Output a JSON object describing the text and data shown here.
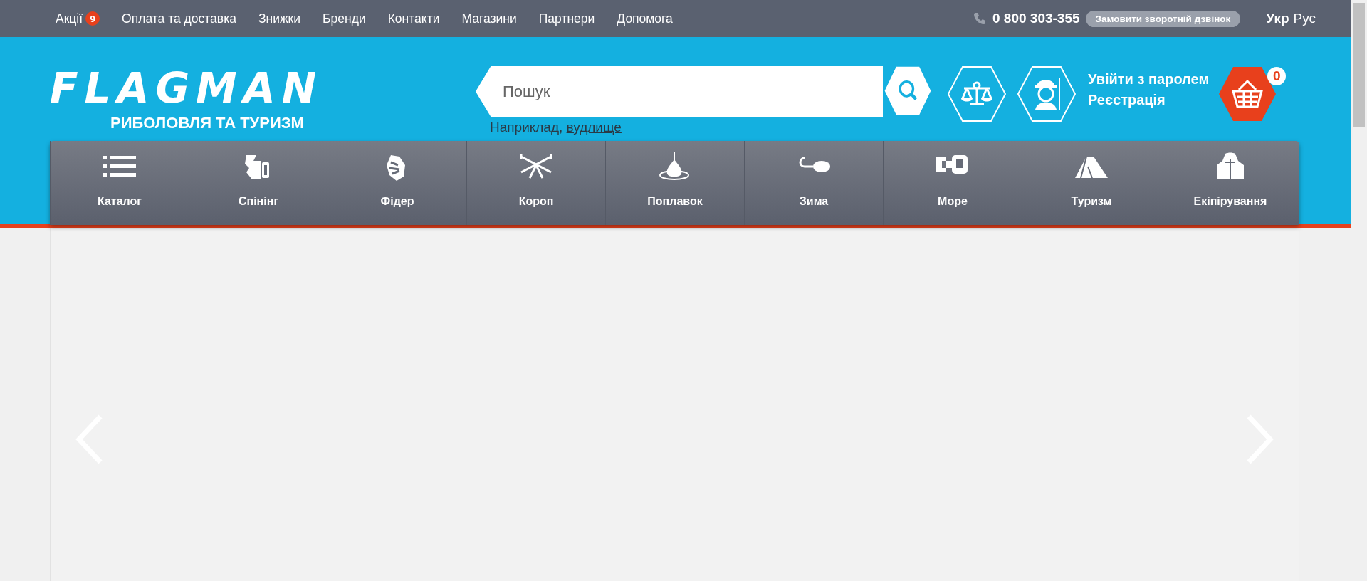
{
  "top_links": [
    {
      "label": "Акції",
      "badge": "9"
    },
    {
      "label": "Оплата та доставка"
    },
    {
      "label": "Знижки"
    },
    {
      "label": "Бренди"
    },
    {
      "label": "Контакти"
    },
    {
      "label": "Магазини"
    },
    {
      "label": "Партнери"
    },
    {
      "label": "Допомога"
    }
  ],
  "phone": "0 800 303-355",
  "callback_button": "Замовити зворотній дзвінок",
  "languages": [
    {
      "label": "Укр",
      "selected": true
    },
    {
      "label": "Рус",
      "selected": false
    }
  ],
  "logo": {
    "name": "FLAGMAN",
    "tagline": "РИБОЛОВЛЯ ТА ТУРИЗМ"
  },
  "search": {
    "placeholder": "Пошук",
    "hint": "Наприклад,",
    "hint_link": "вудлище"
  },
  "account": {
    "login": "Увійти з паролем",
    "register": "Реєстрація"
  },
  "cart": {
    "count": "0"
  },
  "categories": [
    {
      "label": "Каталог"
    },
    {
      "label": "Спінінг"
    },
    {
      "label": "Фідер"
    },
    {
      "label": "Короп"
    },
    {
      "label": "Поплавок"
    },
    {
      "label": "Зима"
    },
    {
      "label": "Море"
    },
    {
      "label": "Туризм"
    },
    {
      "label": "Екіпірування"
    }
  ]
}
